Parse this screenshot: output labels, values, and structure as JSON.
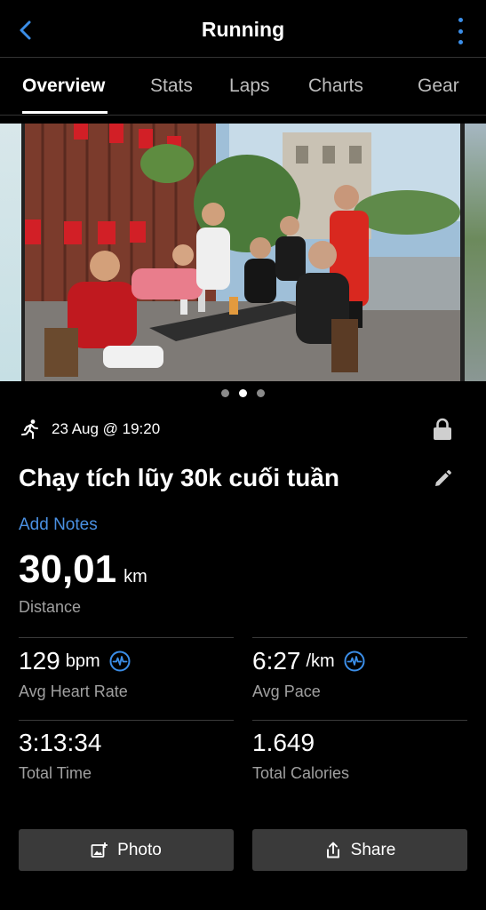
{
  "header": {
    "title": "Running"
  },
  "tabs": [
    {
      "label": "Overview",
      "active": true
    },
    {
      "label": "Stats"
    },
    {
      "label": "Laps"
    },
    {
      "label": "Charts"
    },
    {
      "label": "Gear"
    }
  ],
  "carousel": {
    "page_count": 3,
    "active_index": 1
  },
  "activity": {
    "type_icon": "running-person-icon",
    "datetime": "23 Aug @ 19:20",
    "name": "Chạy tích lũy 30k cuối tuần",
    "add_notes": "Add Notes"
  },
  "distance": {
    "value": "30,01",
    "unit": "km",
    "label": "Distance"
  },
  "stats": {
    "heart_rate": {
      "value": "129",
      "unit": "bpm",
      "label": "Avg Heart Rate"
    },
    "pace": {
      "value": "6:27",
      "unit": "/km",
      "label": "Avg Pace"
    },
    "total_time": {
      "value": "3:13:34",
      "label": "Total Time"
    },
    "calories": {
      "value": "1.649",
      "label": "Total Calories"
    }
  },
  "actions": {
    "photo_label": "Photo",
    "share_label": "Share"
  },
  "colors": {
    "accent": "#3b8ee8",
    "link": "#4a90e2",
    "background": "#000000",
    "button": "#3a3a3a"
  }
}
